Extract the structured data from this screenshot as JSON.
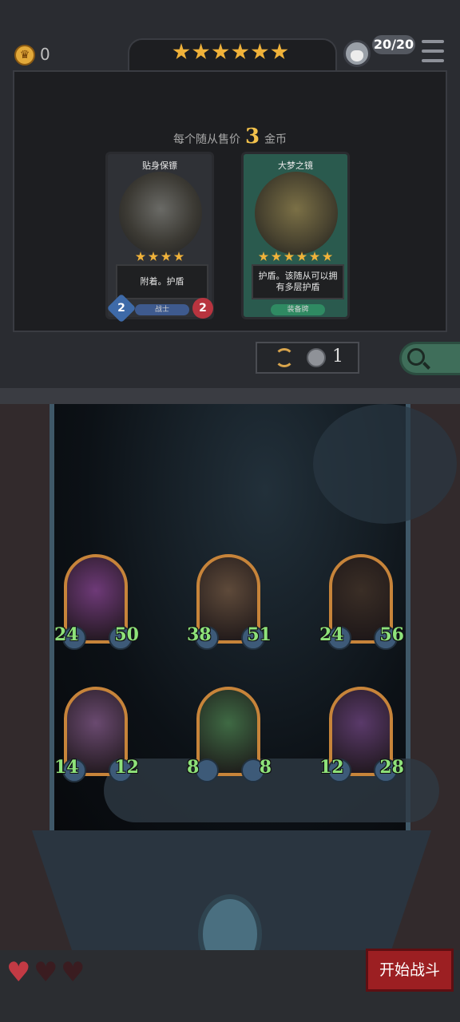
{
  "header": {
    "gold": "0",
    "star_count": 6,
    "capacity": "20/20"
  },
  "shop": {
    "sell_prefix": "每个随从售价",
    "sell_price": "3",
    "sell_suffix": "金币",
    "cards": [
      {
        "title": "贴身保镖",
        "stars": 4,
        "description": "附着。护盾",
        "tag": "战士",
        "attack": "2",
        "health": "2"
      },
      {
        "title": "大梦之镜",
        "stars": 6,
        "description": "护盾。该随从可以拥有多层护盾",
        "tag": "装备牌"
      }
    ],
    "refresh_cost": "1"
  },
  "board": {
    "units": [
      {
        "attack": "24",
        "health": "50",
        "color": "#6e3a78"
      },
      {
        "attack": "38",
        "health": "51",
        "color": "#5e4a3a"
      },
      {
        "attack": "24",
        "health": "56",
        "color": "#3a2e26"
      },
      {
        "attack": "14",
        "health": "12",
        "color": "#6a4a70"
      },
      {
        "attack": "8",
        "health": "8",
        "color": "#3f6a44"
      },
      {
        "attack": "12",
        "health": "28",
        "color": "#5a3a6a"
      }
    ]
  },
  "footer": {
    "lives_remaining": 1,
    "lives_total": 3,
    "start_label": "开始战斗"
  }
}
